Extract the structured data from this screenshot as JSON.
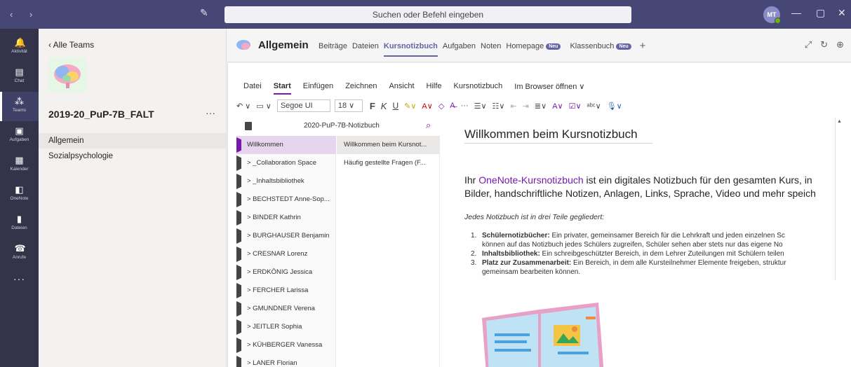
{
  "titlebar": {
    "nav": "‹ ›",
    "search_placeholder": "Suchen oder Befehl eingeben",
    "avatar_initials": "MT",
    "win_min": "—",
    "win_max": "▢",
    "win_close": "✕"
  },
  "rail": {
    "items": [
      {
        "label": "Aktivität",
        "icon": "bell-icon",
        "glyph": "🔔"
      },
      {
        "label": "Chat",
        "icon": "chat-icon",
        "glyph": "▤"
      },
      {
        "label": "Teams",
        "icon": "teams-icon",
        "glyph": "⁂"
      },
      {
        "label": "Aufgaben",
        "icon": "assignments-icon",
        "glyph": "▣"
      },
      {
        "label": "Kalender",
        "icon": "calendar-icon",
        "glyph": "▦"
      },
      {
        "label": "OneNote",
        "icon": "onenote-icon",
        "glyph": "◧"
      },
      {
        "label": "Dateien",
        "icon": "files-icon",
        "glyph": "▮"
      },
      {
        "label": "Anrufe",
        "icon": "phone-icon",
        "glyph": "☎"
      }
    ],
    "more": "···"
  },
  "team": {
    "back": "‹  Alle Teams",
    "name": "2019-20_PuP-7B_FALT",
    "more": "···",
    "channels": [
      "Allgemein",
      "Sozialpsychologie"
    ]
  },
  "header": {
    "channel": "Allgemein",
    "tabs": [
      "Beiträge",
      "Dateien",
      "Kursnotizbuch",
      "Aufgaben",
      "Noten",
      "Homepage",
      "Klassenbuch"
    ],
    "new_badge": "Neu",
    "plus": "+",
    "icons": [
      "⤢",
      "↻",
      "⊕"
    ]
  },
  "ribbon": {
    "tabs": [
      "Datei",
      "Start",
      "Einfügen",
      "Zeichnen",
      "Ansicht",
      "Hilfe",
      "Kursnotizbuch",
      "Im Browser öffnen ∨"
    ],
    "font": "Segoe UI",
    "size": "18",
    "bold": "F",
    "italic": "K",
    "underline": "U",
    "more": "···"
  },
  "notebook": {
    "name": "2020-PuP-7B-Notizbuch",
    "sections": [
      "Willkommen",
      "> _Collaboration Space",
      "> _Inhaltsbibliothek",
      "> BECHSTEDT Anne-Sop...",
      "> BINDER Kathrin",
      "> BURGHAUSER Benjamin",
      "> CRESNAR Lorenz",
      "> ERDKÖNIG Jessica",
      "> FERCHER Larissa",
      "> GMUNDNER Verena",
      "> JEITLER Sophia",
      "> KÜHBERGER Vanessa",
      "> LANER Florian"
    ],
    "pages": [
      "Willkommen beim Kursnot...",
      "Häufig gestellte Fragen (F..."
    ]
  },
  "page": {
    "title": "Willkommen beim Kursnotizbuch",
    "intro_pre": "Ihr ",
    "intro_link": "OneNote-Kursnotizbuch",
    "intro_post": " ist ein digitales Notizbuch für den gesamten Kurs, in",
    "intro_line2": "Bilder, handschriftliche Notizen, Anlagen, Links, Sprache, Video und mehr speich",
    "subtitle": "Jedes Notizbuch ist in drei Teile gegliedert:",
    "list": [
      {
        "num": "1.",
        "bold": "Schülernotizbücher:",
        "text": " Ein privater, gemeinsamer Bereich für die Lehrkraft und jeden einzelnen Sc",
        "cont": "können auf das Notizbuch jedes Schülers zugreifen, Schüler sehen aber stets nur das eigene No"
      },
      {
        "num": "2.",
        "bold": "Inhaltsbibliothek:",
        "text": " Ein schreibgeschützter Bereich, in dem Lehrer Zuteilungen mit Schülern teilen",
        "cont": ""
      },
      {
        "num": "3.",
        "bold": "Platz zur Zusammenarbeit:",
        "text": " Ein Bereich, in dem alle Kursteilnehmer Elemente freigeben, struktur",
        "cont": "gemeinsam bearbeiten können."
      }
    ]
  },
  "colors": {
    "titlebar": "#464775",
    "rail": "#33344a",
    "accent": "#6264a7",
    "onenote": "#7719aa"
  }
}
